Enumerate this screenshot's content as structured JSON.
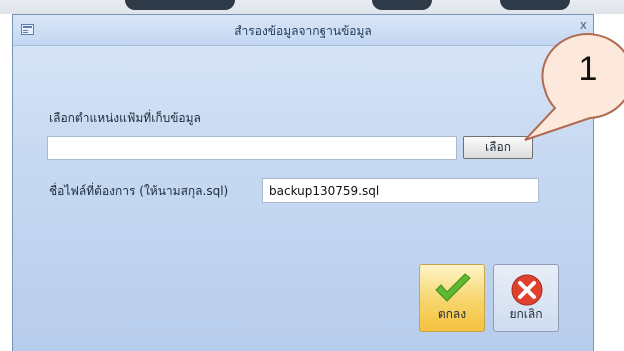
{
  "dialog": {
    "title": "สำรองข้อมูลจากฐานข้อมูล",
    "close_glyph": "x"
  },
  "folder": {
    "label": "เลือกตำแหน่งแฟ้มที่เก็บข้อมูล",
    "value": "",
    "browse_label": "เลือก"
  },
  "filename": {
    "label": "ชื่อไฟล์ที่ต้องการ (ให้นามสกุล.sql)",
    "value": "backup130759.sql"
  },
  "buttons": {
    "ok_label": "ตกลง",
    "ok_icon": "checkmark-icon",
    "cancel_label": "ยกเลิก",
    "cancel_icon": "cancel-x-icon"
  },
  "callout": {
    "number": "1"
  },
  "colors": {
    "ok_check": "#5fb82f",
    "cancel_red": "#e0402e",
    "callout_fill": "#fde9dc",
    "callout_stroke": "#b06a4e"
  }
}
